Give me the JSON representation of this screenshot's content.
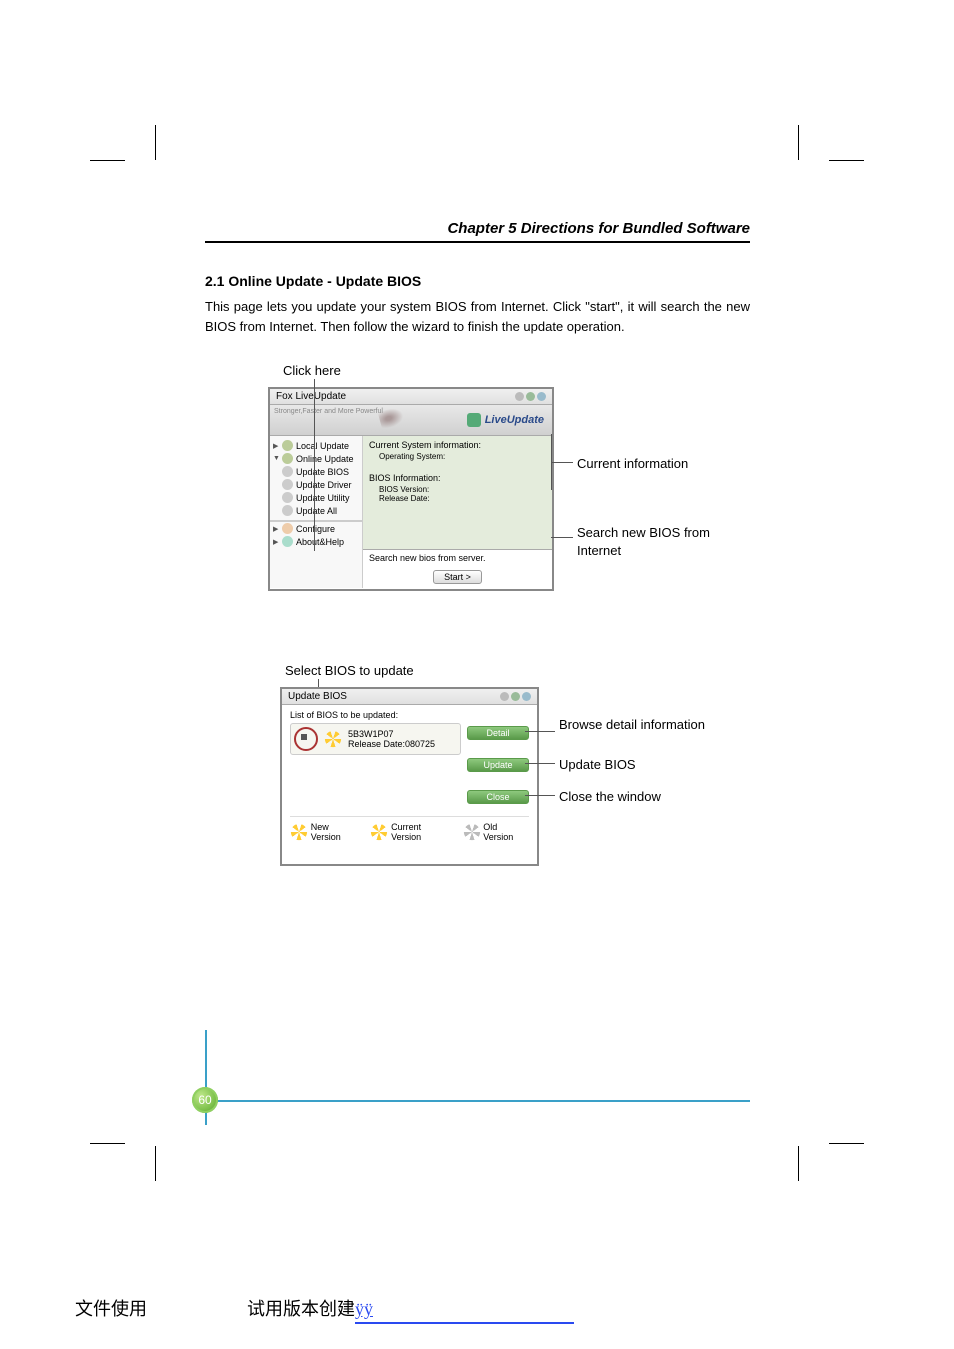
{
  "doc": {
    "chapter_line": "Chapter 5     Directions for Bundled Software",
    "section_heading": "2.1 Online Update - Update BIOS",
    "body_text": "This page lets you update your system BIOS from Internet. Click \"start\", it will search the new BIOS from Internet. Then follow the wizard to finish the update operation.",
    "page_num": "60"
  },
  "fig1": {
    "caption_top": "Click here",
    "callouts": {
      "current_info": "Current information",
      "search_new": "Search new BIOS from Internet"
    },
    "window": {
      "title": "Fox LiveUpdate",
      "banner_tagline": "Stronger,Faster and More Powerful",
      "banner_brand": "LiveUpdate",
      "sidebar": {
        "local_update": "Local Update",
        "online_update": "Online Update",
        "sub": [
          "Update BIOS",
          "Update Driver",
          "Update Utility",
          "Update All"
        ],
        "configure": "Configure",
        "about_help": "About&Help"
      },
      "content": {
        "current_sys_info": "Current System information:",
        "operating_system": "Operating System:",
        "bios_info": "BIOS Information:",
        "bios_version": "BIOS Version:",
        "release_date": "Release Date:",
        "search_label": "Search new bios from server.",
        "start_btn": "Start  >"
      }
    }
  },
  "fig2": {
    "caption_top": "Select BIOS to update",
    "callouts": {
      "browse_detail": "Browse detail information",
      "update_bios": "Update BIOS",
      "close_window": "Close the window"
    },
    "window": {
      "title": "Update BIOS",
      "list_label": "List of BIOS to be updated:",
      "card": {
        "name": "5B3W1P07",
        "release": "Release Date:080725"
      },
      "buttons": {
        "detail": "Detail",
        "update": "Update",
        "close": "Close"
      },
      "legend": {
        "new": "New Version",
        "current": "Current Version",
        "old": "Old Version"
      }
    }
  },
  "footer": {
    "left": "文件使用",
    "right_prefix": "试用版本创建 ",
    "link": "ÿÿ"
  }
}
